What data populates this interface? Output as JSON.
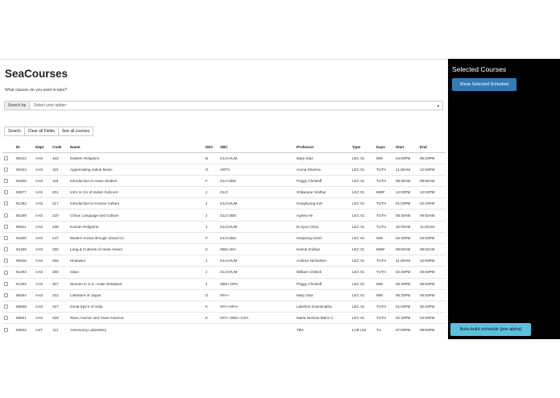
{
  "app": {
    "title": "SeaCourses",
    "subtitle": "What classes do you want to take?"
  },
  "search": {
    "by_label": "Search by",
    "placeholder": "Select your option",
    "caret": "▼"
  },
  "buttons": {
    "search": "Search",
    "clear": "Clear all Fields",
    "see_all": "See all courses"
  },
  "table": {
    "columns": [
      "",
      "ID",
      "Dept",
      "Code",
      "Name",
      "DEC",
      "SBC",
      "Professor",
      "Type",
      "Days",
      "Start",
      "End"
    ],
    "rows": [
      [
        "86222",
        "AAS",
        "102",
        "Eastern Religions",
        "B",
        "GLO;HUM",
        "Mary Diaz",
        "LEC 01",
        "MW",
        "04:00PM",
        "05:20PM"
      ],
      [
        "90323",
        "AAS",
        "110",
        "Appreciating Indian Music",
        "G",
        "ARTS",
        "Aruna Sharma",
        "LEC 01",
        "TUTH",
        "11:30AM",
        "12:50PM"
      ],
      [
        "91505",
        "AAS",
        "118",
        "Introduction to Asian Studies",
        "F",
        "GLO;SBS",
        "Peggy Christoff",
        "LEC 01",
        "TUTH",
        "08:30AM",
        "09:50AM"
      ],
      [
        "82877",
        "AAS",
        "201",
        "Intro to Civ of Indian Subcont",
        "J",
        "GLO",
        "Shikanpur Sridhar",
        "LEC 01",
        "MWF",
        "12:00PM",
        "12:53PM"
      ],
      [
        "91292",
        "AAS",
        "217",
        "Introduction to Korean Culture",
        "J",
        "GLO;HUM",
        "Hongkyung Kim",
        "LEC 01",
        "TUTH",
        "01:00PM",
        "02:20PM"
      ],
      [
        "86189",
        "AAS",
        "220",
        "China: Language and Culture",
        "J",
        "GLO;SBS",
        "Agnes He",
        "LEC 01",
        "TUTH",
        "08:30AM",
        "09:50AM"
      ],
      [
        "90811",
        "AAS",
        "236",
        "Korean Religions",
        "J",
        "GLO;HUM",
        "B.Hyun Choo",
        "LEC 01",
        "TUTH",
        "10:00AM",
        "11:20AM"
      ],
      [
        "94200",
        "AAS",
        "247",
        "Modern Korea through Visual Cu",
        "F",
        "GLO;SBS",
        "Heejeong Sohn",
        "LEC 01",
        "MW",
        "02:30PM",
        "03:50PM"
      ],
      [
        "94196",
        "AAS",
        "250",
        "Lang.& Cultures of Asian Amers",
        "K",
        "SBS;USA",
        "Kamal Sridhar",
        "LEC 01",
        "MWF",
        "09:00AM",
        "09:53AM"
      ],
      [
        "90636",
        "AAS",
        "256",
        "Hinduism",
        "J",
        "GLO;HUM",
        "Andrew Nicholson",
        "LEC 01",
        "TUTH",
        "11:30AM",
        "12:50PM"
      ],
      [
        "91293",
        "AAS",
        "280",
        "Islam",
        "J",
        "GLO;HUM",
        "William Chittick",
        "LEC 01",
        "TUTH",
        "02:30PM",
        "03:50PM"
      ],
      [
        "91304",
        "AAS",
        "307",
        "Women in U.S.-Asian Relations",
        "J",
        "SBS+;SPK",
        "Peggy Christoff",
        "LEC 01",
        "MW",
        "05:30PM",
        "06:50PM"
      ],
      [
        "88484",
        "AAS",
        "322",
        "Literature of Japan",
        "G",
        "HFA+",
        "Mary Diaz",
        "LEC 01",
        "MW",
        "05:30PM",
        "06:50PM"
      ],
      [
        "88508",
        "AAS",
        "327",
        "Great Epics of India",
        "K",
        "HFA+HFA+",
        "Lakshmi Sivaminatha",
        "LEC 01",
        "TUTH",
        "01:00PM",
        "02:20PM"
      ],
      [
        "89821",
        "AAS",
        "328",
        "Race, Humor and Asian America",
        "K",
        "HFA+;SBS+;USA",
        "Maria Nerissa Balce C",
        "LEC 01",
        "TUTH",
        "02:30PM",
        "03:50PM"
      ],
      [
        "83942",
        "AST",
        "112",
        "Astronomy Laboratory",
        "",
        "",
        "TBA",
        "LAB L01",
        "TU",
        "07:00PM",
        "09:50PM"
      ]
    ]
  },
  "sidebar": {
    "title": "Selected Courses",
    "show_button": "Show Selected Schedule",
    "auto_button": "Auto-build schedule (pre-alpha)"
  },
  "colors": {
    "primary": "#337ab7",
    "info": "#5bc0de",
    "sidebar_bg": "#000000"
  }
}
